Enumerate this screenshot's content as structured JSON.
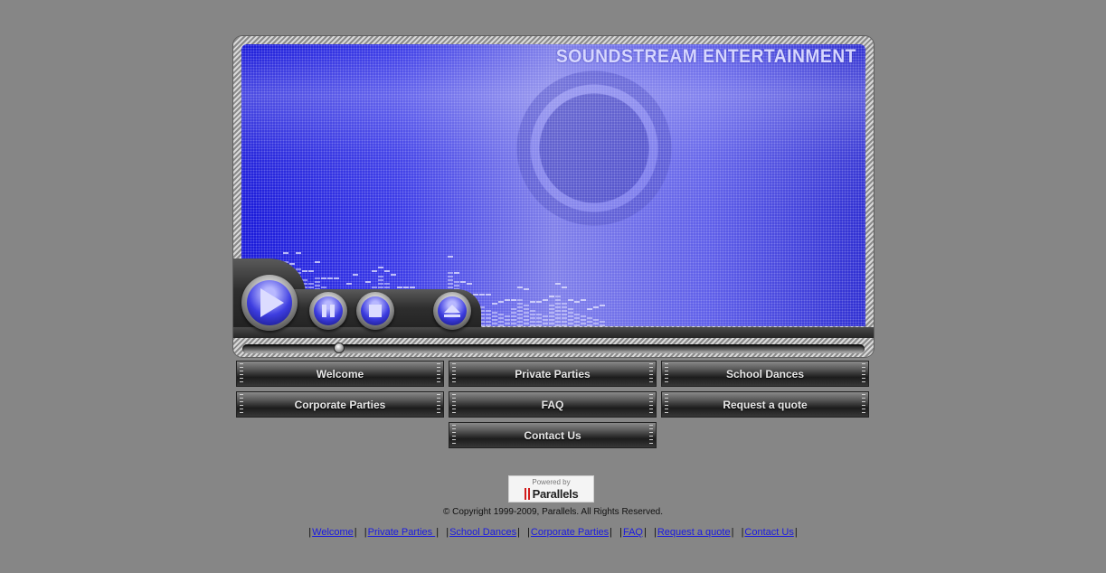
{
  "brand": "SOUNDSTREAM ENTERTAINMENT",
  "player": {
    "play_icon": "play-icon",
    "pause_icon": "pause-icon",
    "stop_icon": "stop-icon",
    "eject_icon": "eject-icon",
    "seek_position": 0.15,
    "accent": "#2a2ae0"
  },
  "nav": [
    "Welcome",
    "Private Parties",
    "School Dances",
    "Corporate Parties",
    "FAQ",
    "Request a quote",
    "Contact Us"
  ],
  "powered": {
    "small": "Powered by",
    "name": "Parallels"
  },
  "copyright": "© Copyright 1999-2009, Parallels. All Rights Reserved.",
  "footer_links": [
    "Welcome",
    "Private Parties ",
    "School Dances",
    "Corporate Parties",
    "FAQ",
    "Request a quote",
    "Contact Us"
  ]
}
